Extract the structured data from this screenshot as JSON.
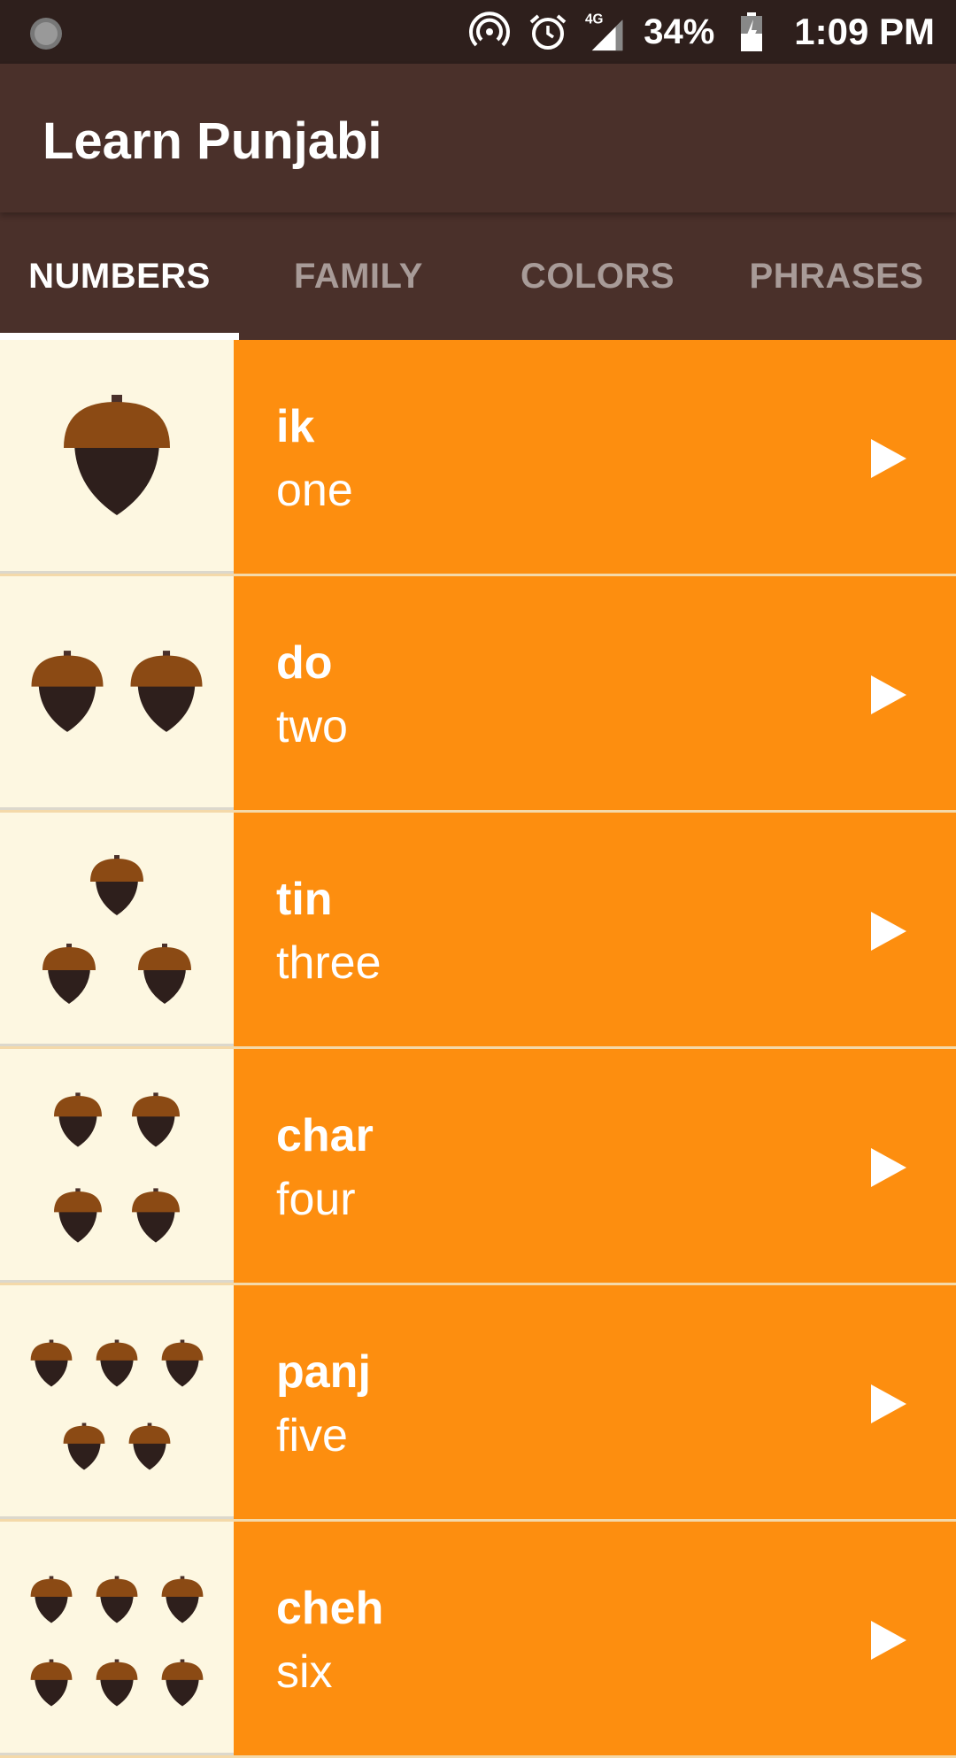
{
  "status_bar": {
    "battery": "34%",
    "time": "1:09 PM",
    "network": "4G"
  },
  "app": {
    "title": "Learn Punjabi"
  },
  "tabs": [
    {
      "label": "NUMBERS"
    },
    {
      "label": "FAMILY"
    },
    {
      "label": "COLORS"
    },
    {
      "label": "PHRASES"
    }
  ],
  "words": [
    {
      "punjabi": "ik",
      "english": "one",
      "count": 1
    },
    {
      "punjabi": "do",
      "english": "two",
      "count": 2
    },
    {
      "punjabi": "tin",
      "english": "three",
      "count": 3
    },
    {
      "punjabi": "char",
      "english": "four",
      "count": 4
    },
    {
      "punjabi": "panj",
      "english": "five",
      "count": 5
    },
    {
      "punjabi": "cheh",
      "english": "six",
      "count": 6
    }
  ],
  "colors": {
    "status_bar": "#2E1F1C",
    "app_bar": "#4A302A",
    "card": "#FD8E0F",
    "image_bg": "#FDF7E1",
    "acorn_cap": "#8B4A14",
    "acorn_body": "#2E1F1C"
  }
}
